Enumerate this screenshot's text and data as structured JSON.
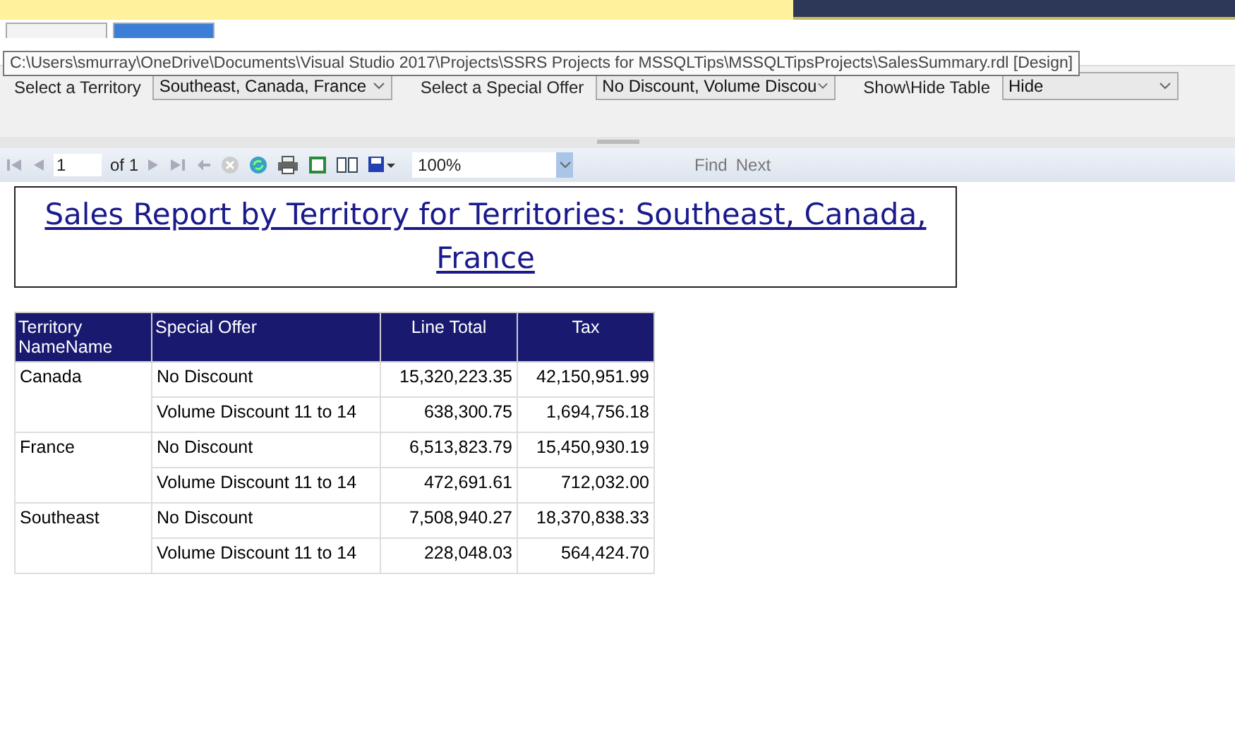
{
  "view_tabs": [
    {
      "selected": false
    },
    {
      "selected": true
    }
  ],
  "tooltip": "C:\\Users\\smurray\\OneDrive\\Documents\\Visual Studio 2017\\Projects\\SSRS Projects for MSSQLTips\\MSSQLTipsProjects\\SalesSummary.rdl [Design]",
  "parameters": [
    {
      "label": "Select a Territory",
      "value": "Southeast, Canada, France"
    },
    {
      "label": "Select a Special Offer",
      "value": "No Discount, Volume Discou"
    },
    {
      "label": "Show\\Hide Table",
      "value": "Hide"
    }
  ],
  "toolbar": {
    "page": "1",
    "of": "of 1",
    "zoom": "100%",
    "find": "Find",
    "next": "Next"
  },
  "report": {
    "title": "Sales Report by Territory for Territories: Southeast, Canada, France",
    "columns": [
      "Territory NameName",
      "Special Offer",
      "Line Total",
      "Tax"
    ],
    "groups": [
      {
        "territory": "Canada",
        "rows": [
          [
            "No Discount",
            "15,320,223.35",
            "42,150,951.99"
          ],
          [
            "Volume Discount 11 to 14",
            "638,300.75",
            "1,694,756.18"
          ]
        ]
      },
      {
        "territory": "France",
        "rows": [
          [
            "No Discount",
            "6,513,823.79",
            "15,450,930.19"
          ],
          [
            "Volume Discount 11 to 14",
            "472,691.61",
            "712,032.00"
          ]
        ]
      },
      {
        "territory": "Southeast",
        "rows": [
          [
            "No Discount",
            "7,508,940.27",
            "18,370,838.33"
          ],
          [
            "Volume Discount 11 to 14",
            "228,048.03",
            "564,424.70"
          ]
        ]
      }
    ]
  }
}
